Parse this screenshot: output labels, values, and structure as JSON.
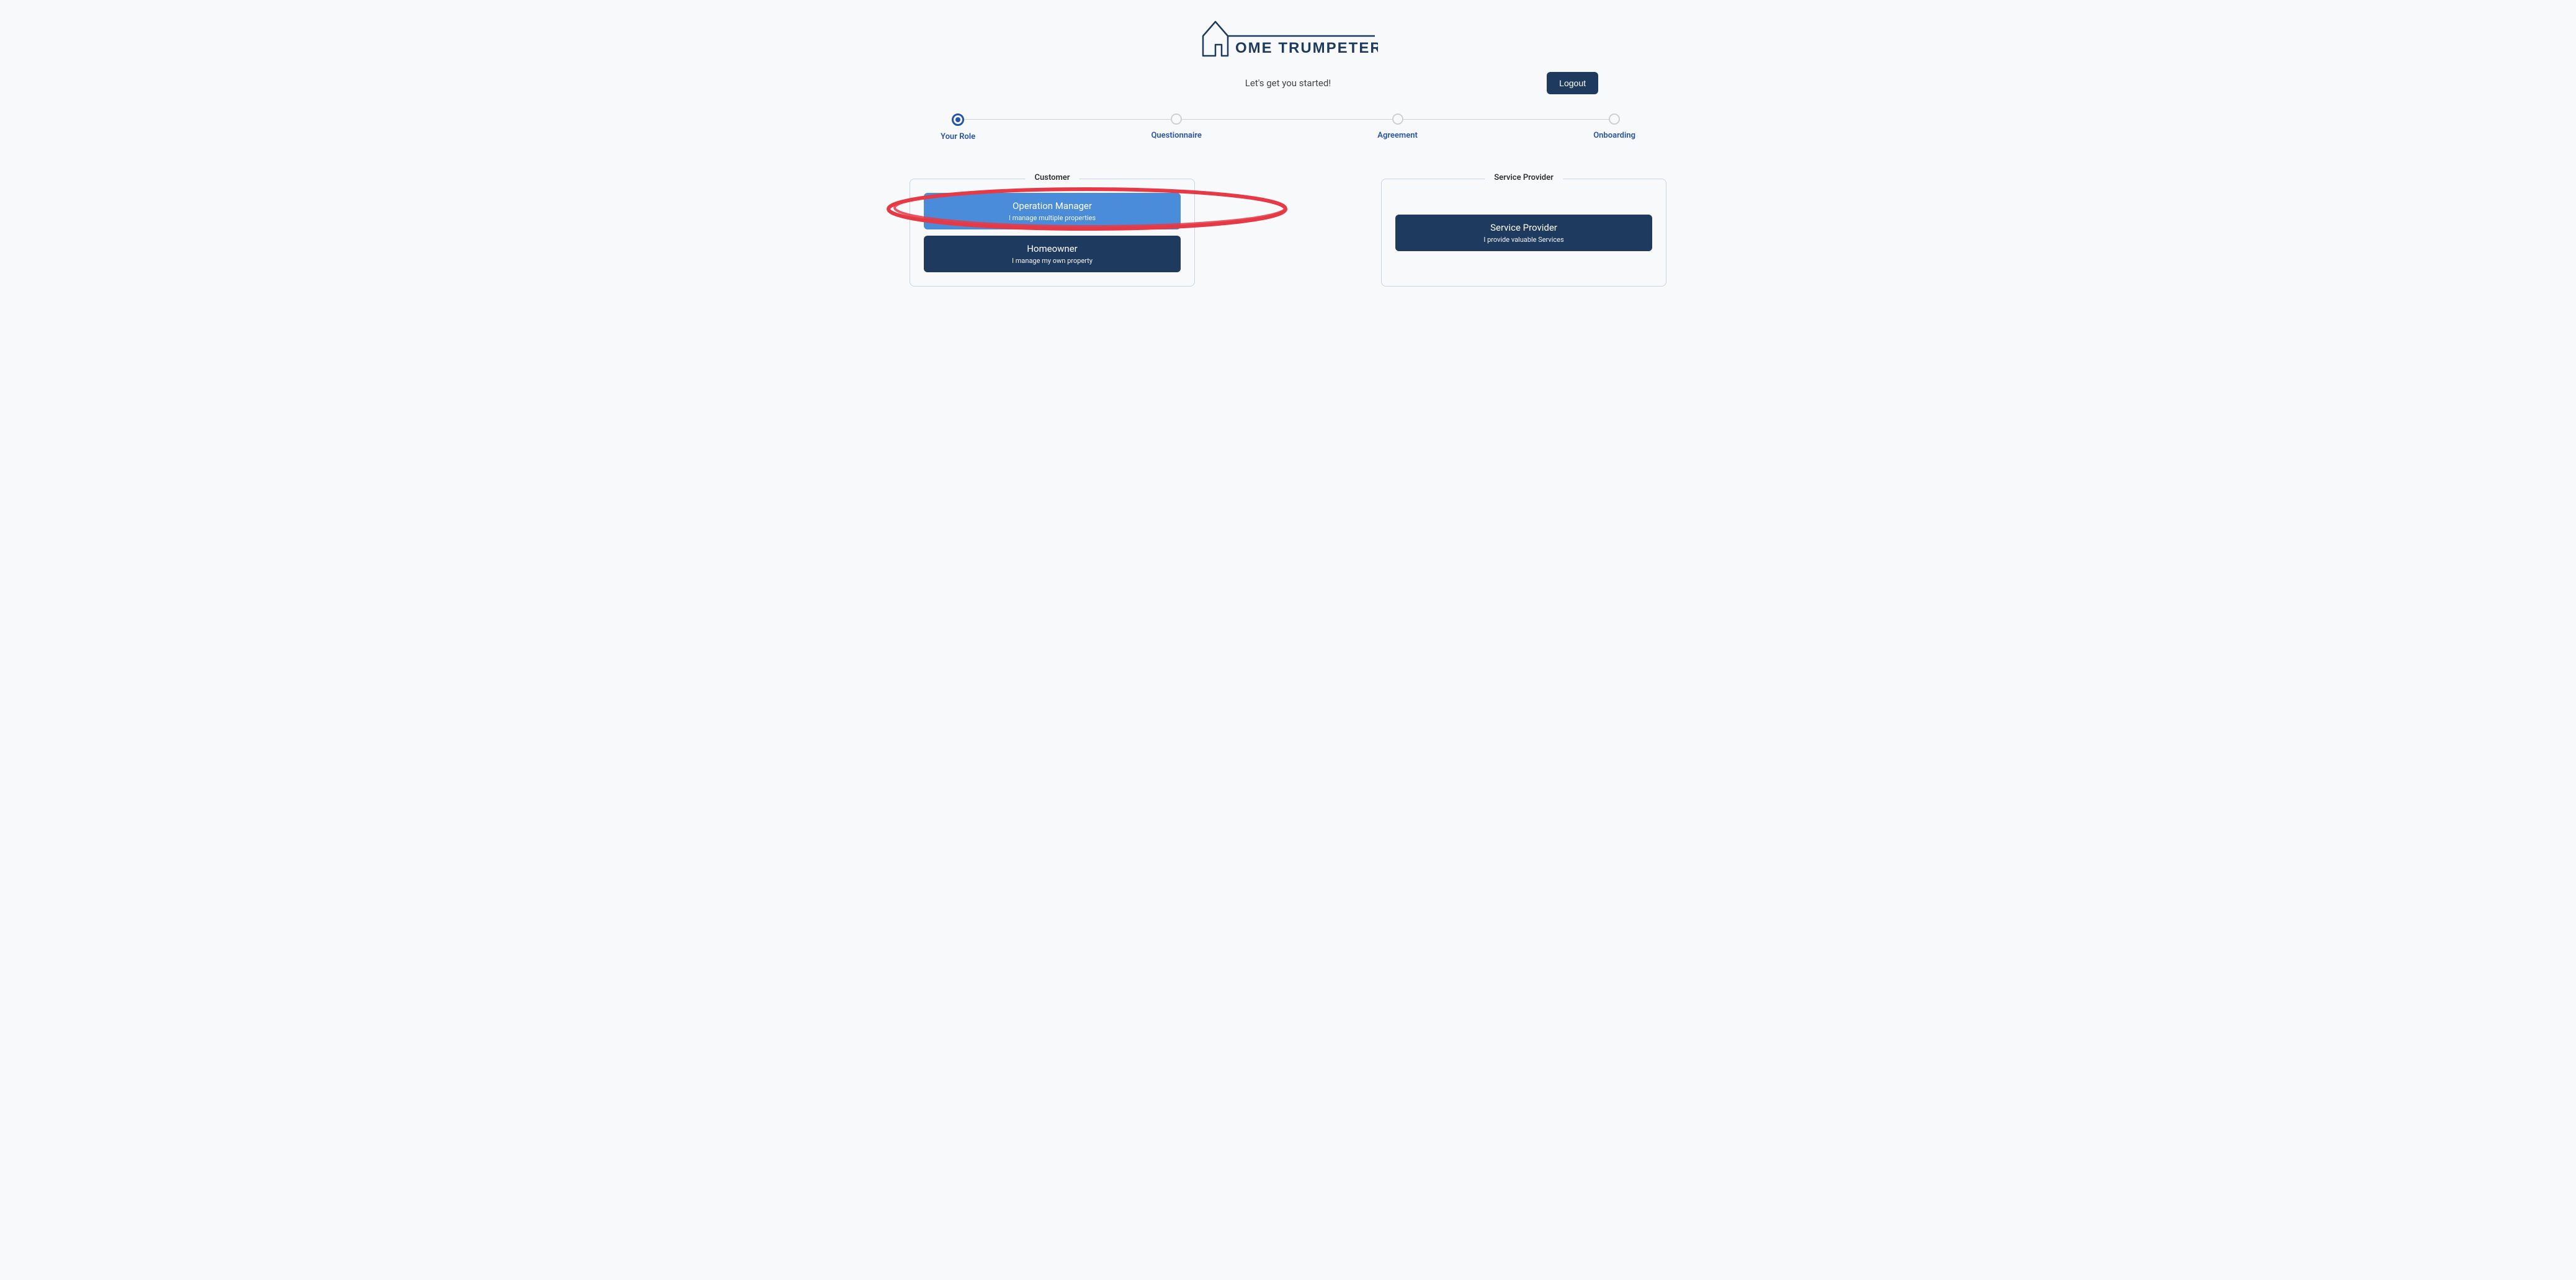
{
  "brand": {
    "name": "OME TRUMPETER"
  },
  "header": {
    "subtitle": "Let's get you started!",
    "logout_label": "Logout"
  },
  "stepper": {
    "steps": [
      {
        "label": "Your Role",
        "active": true
      },
      {
        "label": "Questionnaire",
        "active": false
      },
      {
        "label": "Agreement",
        "active": false
      },
      {
        "label": "Onboarding",
        "active": false
      }
    ]
  },
  "sections": {
    "customer": {
      "title": "Customer",
      "options": [
        {
          "title": "Operation Manager",
          "description": "I manage multiple properties",
          "selected": true
        },
        {
          "title": "Homeowner",
          "description": "I manage my own property",
          "selected": false
        }
      ]
    },
    "provider": {
      "title": "Service Provider",
      "options": [
        {
          "title": "Service Provider",
          "description": "I provide valuable Services",
          "selected": false
        }
      ]
    }
  }
}
